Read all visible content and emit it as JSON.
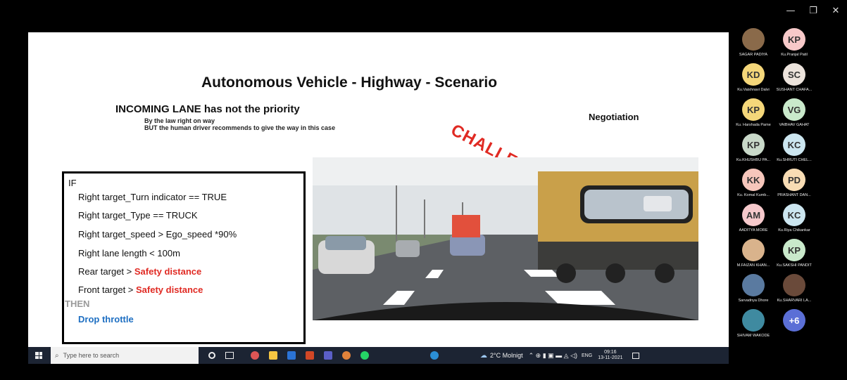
{
  "window_controls": {
    "minimize": "—",
    "restore": "❐",
    "close": "✕"
  },
  "slide": {
    "title": "Autonomous Vehicle - Highway - Scenario",
    "incoming_lane": "INCOMING LANE has not the priority",
    "sub_line_1": "By the law right on way",
    "sub_line_2": "BUT the human driver recommends to  give the way in this case",
    "negotiation": "Negotiation",
    "challenge": "CHALLENGE",
    "rules": {
      "if": "IF",
      "r1": "Right target_Turn indicator == TRUE",
      "r2": "Right target_Type == TRUCK",
      "r3": "Right target_speed > Ego_speed *90%",
      "r4": "Right lane length < 100m",
      "r5_a": "Rear target  > ",
      "r5_b": "Safety distance",
      "r6_a": "Front target  >  ",
      "r6_b": "Safety distance",
      "then": "THEN",
      "action": "Drop throttle"
    }
  },
  "participants": [
    {
      "initials": "",
      "name": "SAGAR PADIYA",
      "color": "#8a6a4a",
      "photo": true
    },
    {
      "initials": "KP",
      "name": "Ku.Pranjal Patil",
      "color": "#f7c9c9"
    },
    {
      "initials": "KD",
      "name": "Ku.Vaishnavi Dalvi",
      "color": "#f5d77a"
    },
    {
      "initials": "SC",
      "name": "SUSHANT CHAFA...",
      "color": "#ece3dc"
    },
    {
      "initials": "KP",
      "name": "Ku. Harshada Pame",
      "color": "#f5d77a"
    },
    {
      "initials": "VG",
      "name": "VAIBHAV GAHAT",
      "color": "#c9e9cb"
    },
    {
      "initials": "KP",
      "name": "Ku.KHUSHBU PA...",
      "color": "#c9d9c9"
    },
    {
      "initials": "KC",
      "name": "Ku.SHRUTI CHEL...",
      "color": "#cce6f0"
    },
    {
      "initials": "KK",
      "name": "Ku. Komal Kumb...",
      "color": "#f6c6bb"
    },
    {
      "initials": "PD",
      "name": "PRASHANT DAN...",
      "color": "#f8dcb4"
    },
    {
      "initials": "AM",
      "name": "AADITYA MORE",
      "color": "#f6c9cc"
    },
    {
      "initials": "KC",
      "name": "Ku.Riya Chikankar",
      "color": "#cce6f0"
    },
    {
      "initials": "",
      "name": "M.FAIZAN KHAN...",
      "color": "#d9b38c",
      "photo": true
    },
    {
      "initials": "KP",
      "name": "Ku.SAKSHI PANDIT",
      "color": "#c9e9cb"
    },
    {
      "initials": "",
      "name": "Sarvadnya Dhore",
      "color": "#5a7aa0",
      "photo": true
    },
    {
      "initials": "",
      "name": "Ku.SHARVARI LA...",
      "color": "#6a4a3a",
      "photo": true
    },
    {
      "initials": "",
      "name": "SHIVAM WAKODE",
      "color": "#3f8aa0",
      "photo": true
    },
    {
      "initials": "+6",
      "name": "",
      "color": "#5b6fd6"
    }
  ],
  "taskbar": {
    "search_placeholder": "Type here to search",
    "weather": "2°C  Molnigt",
    "language": "ENG",
    "time": "09:16",
    "date": "13-11-2021"
  }
}
